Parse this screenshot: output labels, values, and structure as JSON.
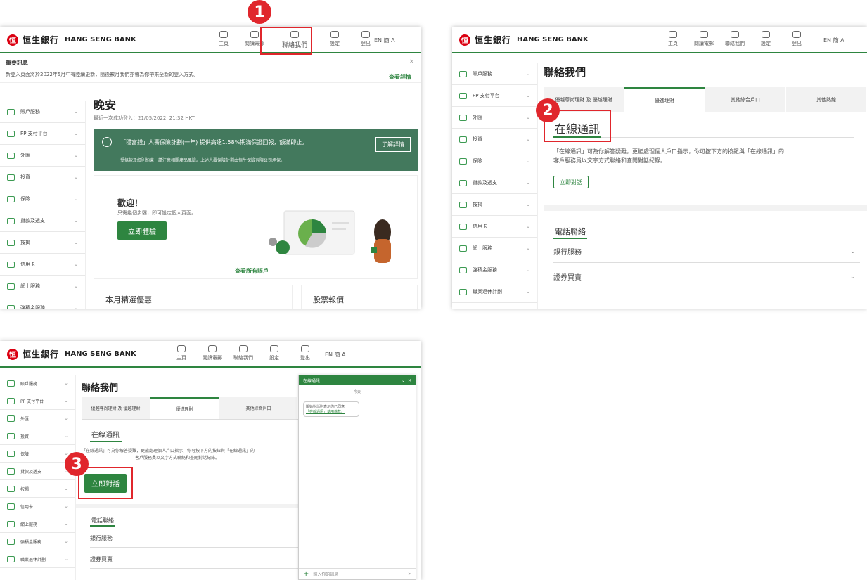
{
  "bank": {
    "logo_mark": "恒",
    "logo_zh": "恒生銀行",
    "logo_en": "HANG SENG BANK"
  },
  "nav": {
    "home": "主頁",
    "mail": "閱讀電郵",
    "contact": "聯絡我們",
    "settings": "設定",
    "logout": "登出",
    "lang": "EN 簡 A"
  },
  "sidebar": {
    "items": [
      "賬戶服務",
      "PP 支付平台",
      "外匯",
      "投資",
      "保險",
      "貸款及透支",
      "按揭",
      "信用卡",
      "網上服務",
      "強積金服務",
      "職業退休計劃"
    ]
  },
  "screen1": {
    "alert_title": "重要訊息",
    "alert_text": "新登入頁面將於2022年5月中有陸續更新，隨後數月我們亦會為你帶來全新的登入方式。",
    "alert_link": "查看詳情",
    "greeting": "晚安",
    "last_login": "最近一次成功登入：21/05/2022, 21:32 HKT",
    "promo_text": "「穩富錢」人壽保險計劃(一年) 提供高達1.58%期滿保證回報，額滿即止。",
    "promo_note": "受條款及細則約束，請注意相關產品風險。上述人壽保險計劃由恒生保險有限公司承保。",
    "promo_button": "了解詳情",
    "welcome_title": "歡迎！",
    "welcome_sub": "只需幾個步驟，即可設定個人頁面。",
    "welcome_button": "立即體驗",
    "all_accounts_link": "查看所有賬戶",
    "card_offers": "本月精選優惠",
    "card_stocks": "股票報價"
  },
  "contact": {
    "title": "聯絡我們",
    "tabs": [
      "優越尊尚理財 及 優越理財",
      "優進理財",
      "其他綜合戶口",
      "其他熱線"
    ],
    "online_chat": "在線通訊",
    "online_desc_1": "「在線通訊」可為你解答疑難，更能處理個人戶口指示，你可按下方的按鈕與「在線通訊」的",
    "online_desc_2": "客戶服務員以文字方式聯絡和查閱對話紀錄。",
    "chat_now": "立即對話",
    "phone_title": "電話聯絡",
    "bank_services": "銀行服務",
    "securities": "證券買賣"
  },
  "chat": {
    "header": "在線通訊",
    "day": "今天",
    "msg_1": "開始對話則表示你已同意",
    "msg_2": "「在線通訊」使用條款。",
    "input_placeholder": "輸入你的訊息"
  },
  "steps": [
    "1",
    "2",
    "3"
  ],
  "colors": {
    "brand_green": "#2e8540",
    "promo_green": "#43795d",
    "highlight_red": "#e0262c",
    "logo_red": "#db0011"
  }
}
